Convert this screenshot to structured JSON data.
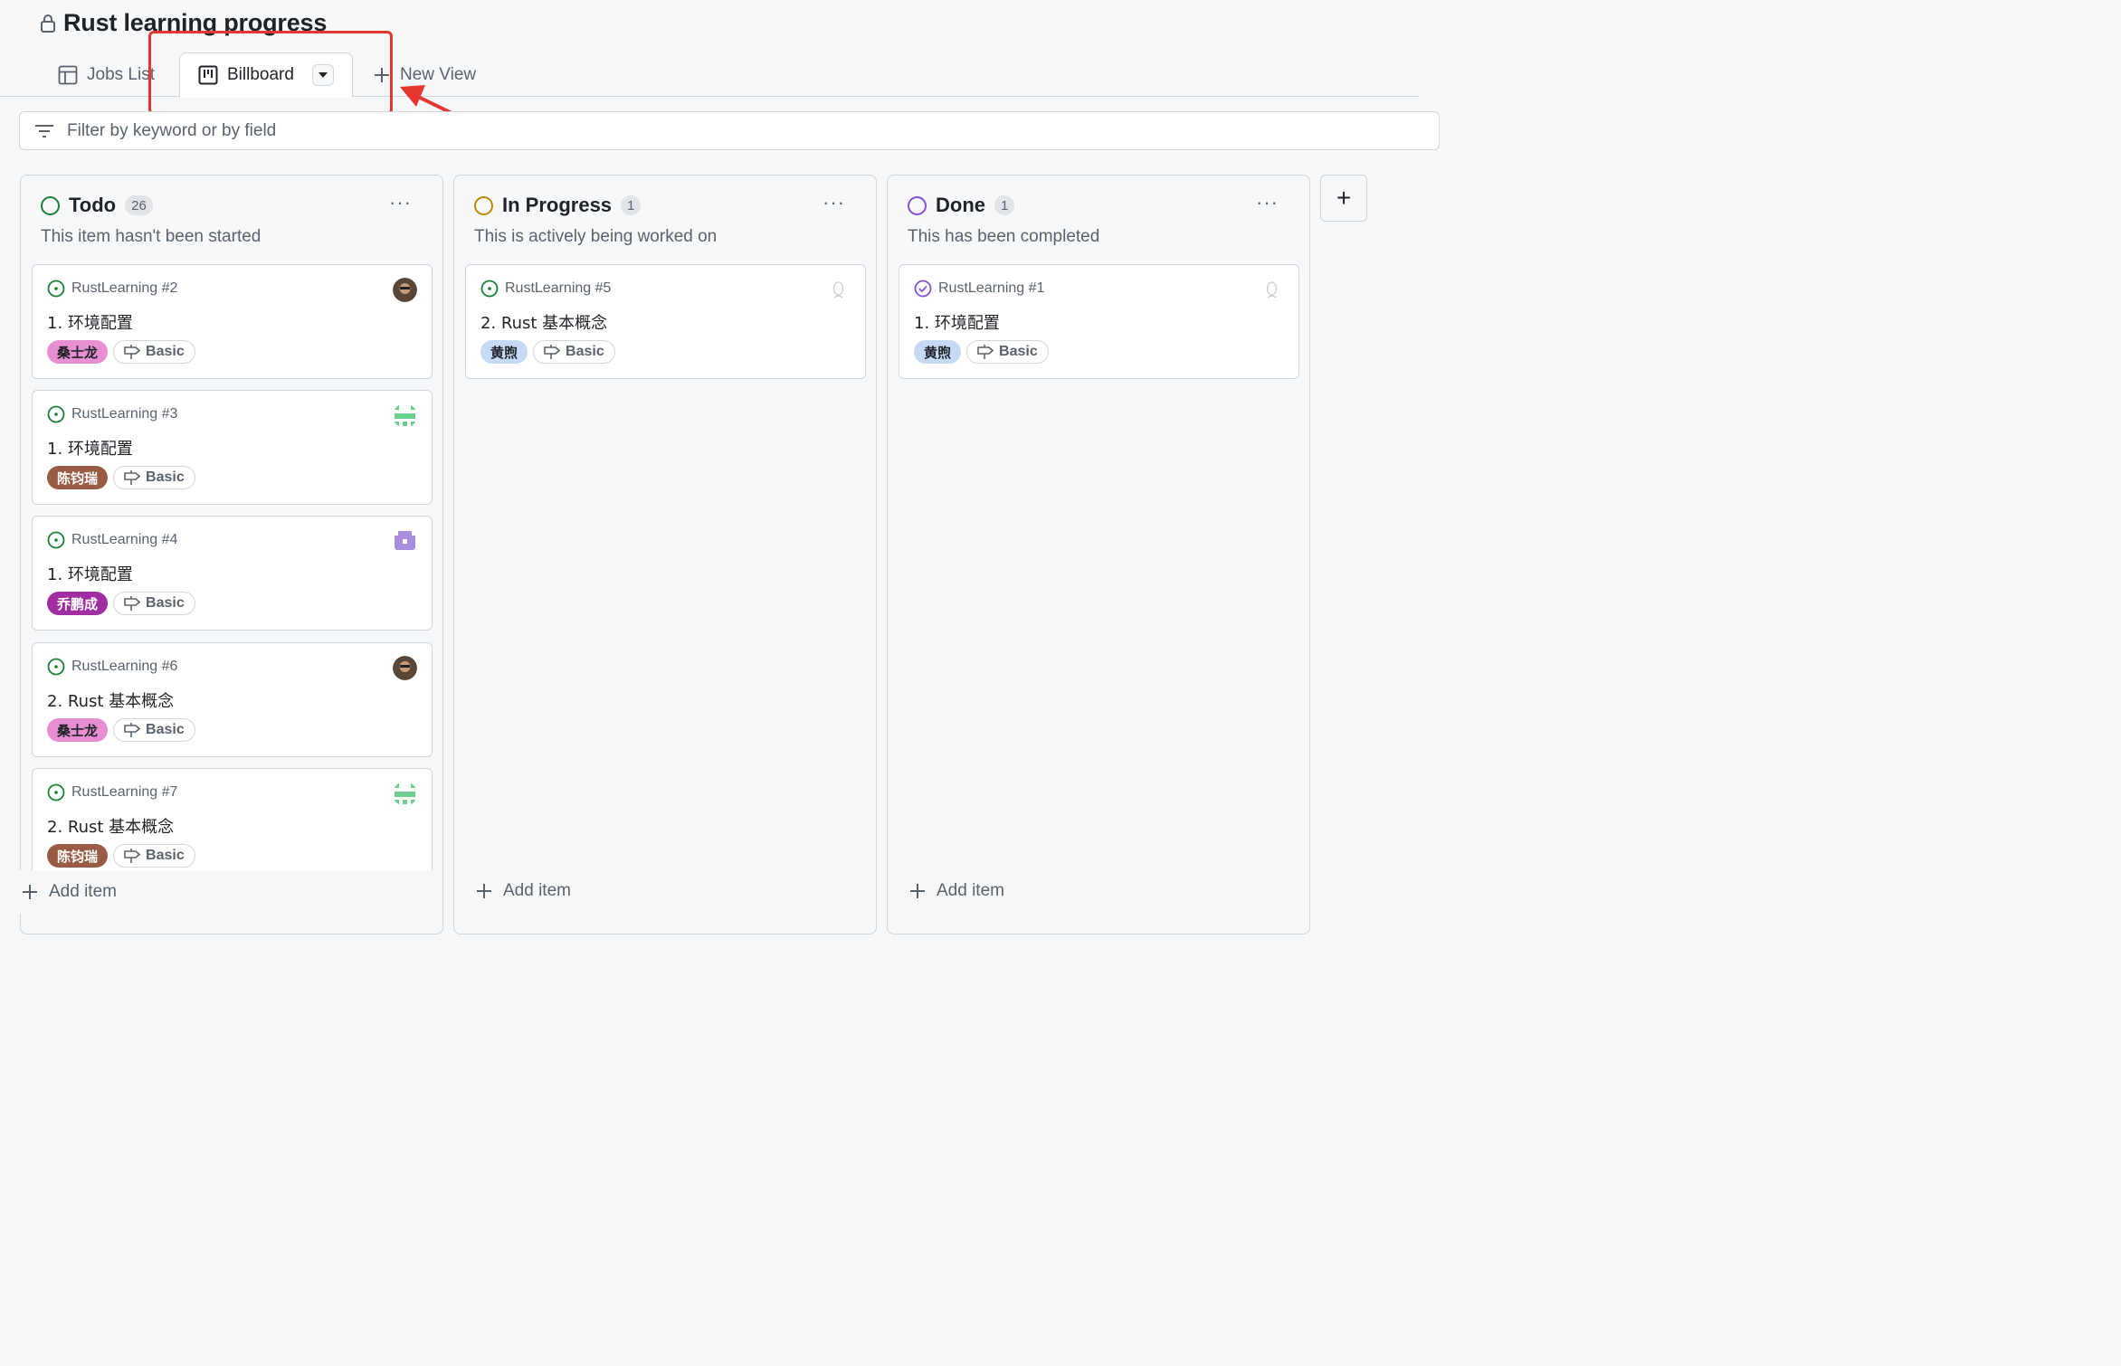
{
  "project": {
    "title": "Rust learning progress",
    "lock_icon": "lock-icon"
  },
  "tabs": [
    {
      "label": "Jobs List",
      "icon": "table-icon"
    },
    {
      "label": "Billboard",
      "icon": "board-icon"
    },
    {
      "label": "New View",
      "icon": "plus-icon"
    }
  ],
  "filter": {
    "placeholder": "Filter by keyword or by field"
  },
  "colors": {
    "annotation": "#e5372f",
    "todo": "#1a7f37",
    "in_progress": "#bf8700",
    "done": "#8250df"
  },
  "columns": [
    {
      "title": "Todo",
      "count": "26",
      "description": "This item hasn't been started",
      "add_label": "Add item",
      "cards": [
        {
          "ref": "RustLearning #2",
          "title": "1. 环境配置",
          "assignee": "桑士龙",
          "label": "Basic"
        },
        {
          "ref": "RustLearning #3",
          "title": "1. 环境配置",
          "assignee": "陈钧瑞",
          "label": "Basic"
        },
        {
          "ref": "RustLearning #4",
          "title": "1. 环境配置",
          "assignee": "乔鹏成",
          "label": "Basic"
        },
        {
          "ref": "RustLearning #6",
          "title": "2. Rust 基本概念",
          "assignee": "桑士龙",
          "label": "Basic"
        },
        {
          "ref": "RustLearning #7",
          "title": "2. Rust 基本概念",
          "assignee": "陈钧瑞",
          "label": "Basic"
        }
      ]
    },
    {
      "title": "In Progress",
      "count": "1",
      "description": "This is actively being worked on",
      "add_label": "Add item",
      "cards": [
        {
          "ref": "RustLearning #5",
          "title": "2. Rust 基本概念",
          "assignee": "黄煦",
          "label": "Basic"
        }
      ]
    },
    {
      "title": "Done",
      "count": "1",
      "description": "This has been completed",
      "add_label": "Add item",
      "cards": [
        {
          "ref": "RustLearning #1",
          "title": "1. 环境配置",
          "assignee": "黄煦",
          "label": "Basic"
        }
      ]
    }
  ],
  "add_column": {
    "label": "+"
  }
}
